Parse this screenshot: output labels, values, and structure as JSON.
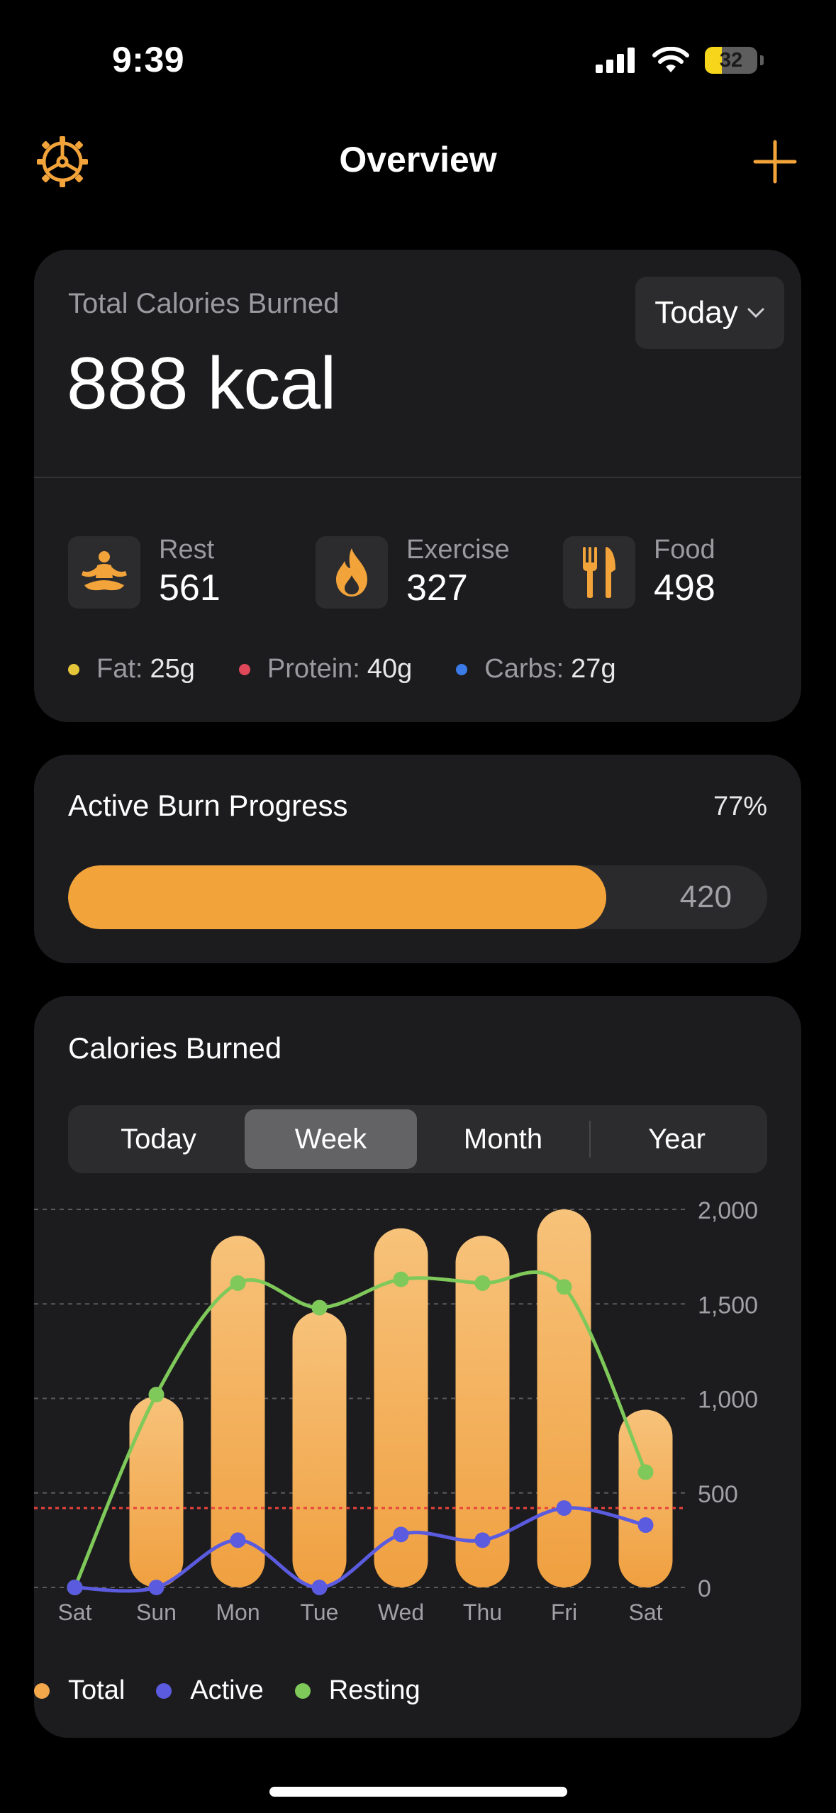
{
  "status": {
    "time": "9:39",
    "battery": "32",
    "battery_level": 0.32
  },
  "header": {
    "title": "Overview"
  },
  "summary": {
    "label": "Total Calories Burned",
    "value": "888 kcal",
    "period": "Today",
    "stats": [
      {
        "label": "Rest",
        "value": "561",
        "icon": "meditation-icon"
      },
      {
        "label": "Exercise",
        "value": "327",
        "icon": "flame-icon"
      },
      {
        "label": "Food",
        "value": "498",
        "icon": "fork-knife-icon"
      }
    ],
    "macros": [
      {
        "label": "Fat:",
        "value": "25g",
        "color": "#e5c63b"
      },
      {
        "label": "Protein:",
        "value": "40g",
        "color": "#e0485a"
      },
      {
        "label": "Carbs:",
        "value": "27g",
        "color": "#3a7be8"
      }
    ]
  },
  "progress": {
    "title": "Active Burn Progress",
    "percent_label": "77%",
    "fraction": 0.77,
    "value": "420"
  },
  "calories_chart": {
    "title": "Calories Burned",
    "tabs": [
      "Today",
      "Week",
      "Month",
      "Year"
    ],
    "active_tab": "Week",
    "legend": [
      {
        "label": "Total",
        "color": "#f4a84c"
      },
      {
        "label": "Active",
        "color": "#5b5be0"
      },
      {
        "label": "Resting",
        "color": "#7fc95a"
      }
    ]
  },
  "chart_data": {
    "type": "bar",
    "categories": [
      "Sat",
      "Sun",
      "Mon",
      "Tue",
      "Wed",
      "Thu",
      "Fri",
      "Sat"
    ],
    "series": [
      {
        "name": "Total",
        "type": "bar",
        "values": [
          0,
          1010,
          1860,
          1460,
          1900,
          1860,
          2000,
          940
        ]
      },
      {
        "name": "Active",
        "type": "line",
        "values": [
          0,
          0,
          250,
          0,
          280,
          250,
          420,
          330
        ]
      },
      {
        "name": "Resting",
        "type": "line",
        "values": [
          0,
          1020,
          1610,
          1480,
          1630,
          1610,
          1590,
          610
        ]
      }
    ],
    "yticks": [
      "0",
      "500",
      "1,000",
      "1,500",
      "2,000"
    ],
    "ylim": [
      0,
      2000
    ],
    "reference_line": 420,
    "grid": true,
    "legend_position": "bottom-left",
    "colors": {
      "bar": "#f4a84c",
      "active": "#5b5be0",
      "resting": "#7fc95a",
      "reference": "#e8433d"
    }
  }
}
